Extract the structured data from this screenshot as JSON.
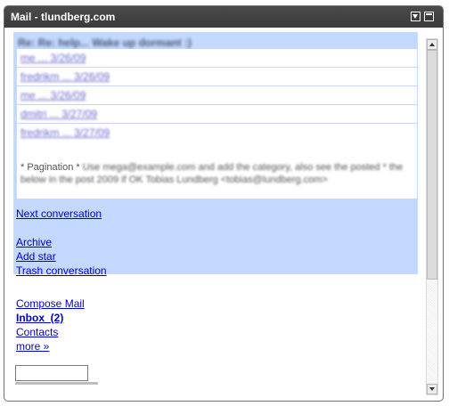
{
  "window": {
    "title": "Mail - tlundberg.com",
    "menu_icon": "dropdown-menu-icon",
    "maximize_icon": "maximize-icon"
  },
  "conversation": {
    "subject": "Re: Re: help... Wake up dormant :)",
    "messages": [
      {
        "label": "me ... 3/26/09"
      },
      {
        "label": "fredrikm ... 3/26/09"
      },
      {
        "label": "me ... 3/26/09"
      },
      {
        "label": "dmitri ... 3/27/09"
      },
      {
        "label": "fredrikm ... 3/27/09"
      }
    ],
    "snippet_prefix": "* Pagination * ",
    "snippet_blurred": "Use mega@example.com and add the category, also see the posted * the below in the post 2009 if OK Tobias Lundberg <tobias@lundberg.com>",
    "next_conversation": "Next conversation",
    "actions": [
      "Archive",
      "Add star",
      "Trash conversation"
    ]
  },
  "nav": {
    "compose": "Compose Mail",
    "inbox": "Inbox  (2)",
    "contacts": "Contacts",
    "more": "more »"
  },
  "search": {
    "value": ""
  },
  "colors": {
    "titlebar": "#3b3b3b",
    "conversation_bg": "#c3d9ff",
    "link": "#0000cc"
  }
}
